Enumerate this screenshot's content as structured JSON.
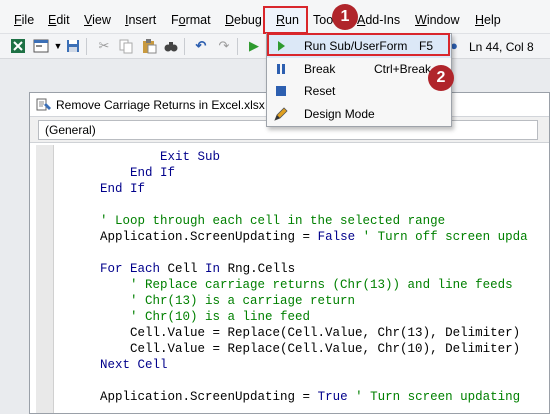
{
  "menubar": {
    "items": [
      {
        "label": "File",
        "key": "F",
        "rest": "ile"
      },
      {
        "label": "Edit",
        "key": "E",
        "rest": "dit"
      },
      {
        "label": "View",
        "key": "V",
        "rest": "iew"
      },
      {
        "label": "Insert",
        "key": "I",
        "rest": "nsert"
      },
      {
        "label": "Format",
        "key": "",
        "prefix": "F",
        "mid": "o",
        "rest": "rmat"
      },
      {
        "label": "Debug",
        "key": "D",
        "rest": "ebug"
      },
      {
        "label": "Run",
        "key": "R",
        "rest": "un"
      },
      {
        "label": "Tools",
        "shown": "Too"
      },
      {
        "label": "Add-Ins",
        "key": "A",
        "rest": "dd-Ins"
      },
      {
        "label": "Window",
        "key": "W",
        "rest": "indow"
      },
      {
        "label": "Help",
        "key": "H",
        "rest": "elp"
      }
    ]
  },
  "toolbar": {
    "cursor_position": "Ln 44, Col 8"
  },
  "run_menu": {
    "items": [
      {
        "label": "Run Sub/UserForm",
        "shortcut": "F5",
        "icon": "play-icon"
      },
      {
        "label": "Break",
        "shortcut": "Ctrl+Break",
        "icon": "pause-icon"
      },
      {
        "label": "Reset",
        "shortcut": "",
        "icon": "stop-icon"
      },
      {
        "label": "Design Mode",
        "shortcut": "",
        "icon": "design-mode-icon"
      }
    ]
  },
  "annotations": {
    "step1": "1",
    "step2": "2"
  },
  "editor": {
    "title": "Remove Carriage Returns in Excel.xlsx - M",
    "object_combo": "(General)",
    "code_lines": [
      {
        "indent": "            ",
        "text": "Exit Sub",
        "type": "kw"
      },
      {
        "indent": "        ",
        "text": "End If",
        "type": "kw"
      },
      {
        "indent": "    ",
        "text": "End If",
        "type": "kw"
      },
      {
        "indent": "",
        "text": "",
        "type": "blank"
      },
      {
        "indent": "    ",
        "text": "' Loop through each cell in the selected range",
        "type": "cm"
      },
      {
        "indent": "    ",
        "text": "Application.ScreenUpdating = False ' Turn off screen upda",
        "type": "mixed"
      },
      {
        "indent": "",
        "text": "",
        "type": "blank"
      },
      {
        "indent": "    ",
        "text": "For Each Cell In Rng.Cells",
        "type": "mixed"
      },
      {
        "indent": "        ",
        "text": "' Replace carriage returns (Chr(13)) and line feeds",
        "type": "cm"
      },
      {
        "indent": "        ",
        "text": "' Chr(13) is a carriage return",
        "type": "cm"
      },
      {
        "indent": "        ",
        "text": "' Chr(10) is a line feed",
        "type": "cm"
      },
      {
        "indent": "        ",
        "text": "Cell.Value = Replace(Cell.Value, Chr(13), Delimiter)",
        "type": "plain"
      },
      {
        "indent": "        ",
        "text": "Cell.Value = Replace(Cell.Value, Chr(10), Delimiter)",
        "type": "plain"
      },
      {
        "indent": "    ",
        "text": "Next Cell",
        "type": "kw"
      },
      {
        "indent": "",
        "text": "",
        "type": "blank"
      },
      {
        "indent": "    ",
        "text": "Application.ScreenUpdating = True ' Turn screen updating",
        "type": "mixed"
      }
    ],
    "mixed_parts": {
      "l5_code": "Application.ScreenUpdating = ",
      "l5_kw": "False",
      "l5_comment": " ' Turn off screen upda",
      "l7_kw1": "For Each",
      "l7_mid": " Cell ",
      "l7_kw2": "In",
      "l7_rest": " Rng.Cells",
      "l15_code": "Application.ScreenUpdating = ",
      "l15_kw": "True",
      "l15_comment": " ' Turn screen updating"
    }
  },
  "colors": {
    "highlight_border": "#d9262c",
    "badge": "#b0252b",
    "keyword": "#00008b",
    "comment": "#008000"
  }
}
